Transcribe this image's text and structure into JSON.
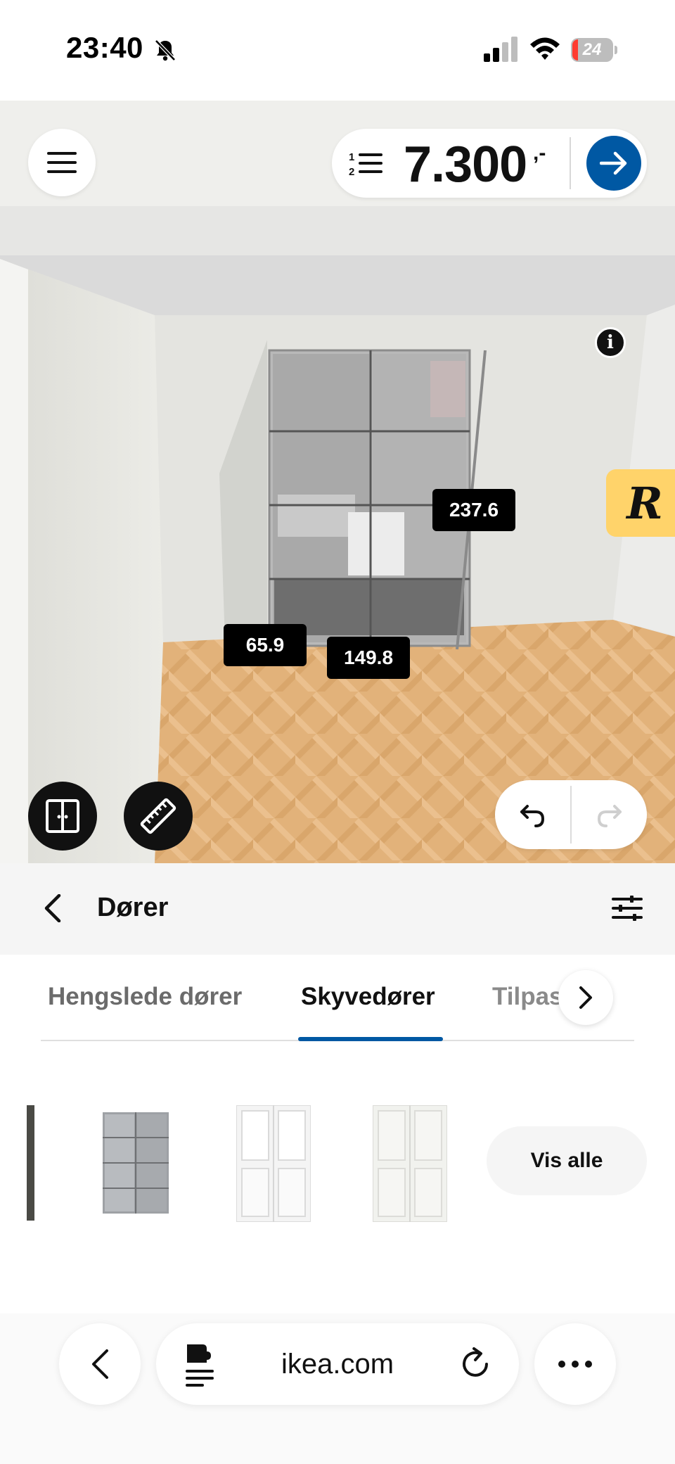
{
  "status_bar": {
    "time": "23:40",
    "battery_level": "24"
  },
  "toolbar": {
    "price": "7.300",
    "price_suffix": ",-"
  },
  "measurements": [
    "237.6",
    "65.9",
    "149.8"
  ],
  "badges": {
    "info": "i",
    "r_logo": "R"
  },
  "category": {
    "title": "Dører"
  },
  "tabs": [
    {
      "label": "Hengslede dører",
      "active": false
    },
    {
      "label": "Skyvedører",
      "active": true
    },
    {
      "label": "Tilpas   e s",
      "active": false
    }
  ],
  "products": {
    "see_all_label": "Vis alle"
  },
  "browser": {
    "url": "ikea.com"
  },
  "colors": {
    "accent": "#0058a3",
    "badge_yellow": "#ffd36a"
  }
}
